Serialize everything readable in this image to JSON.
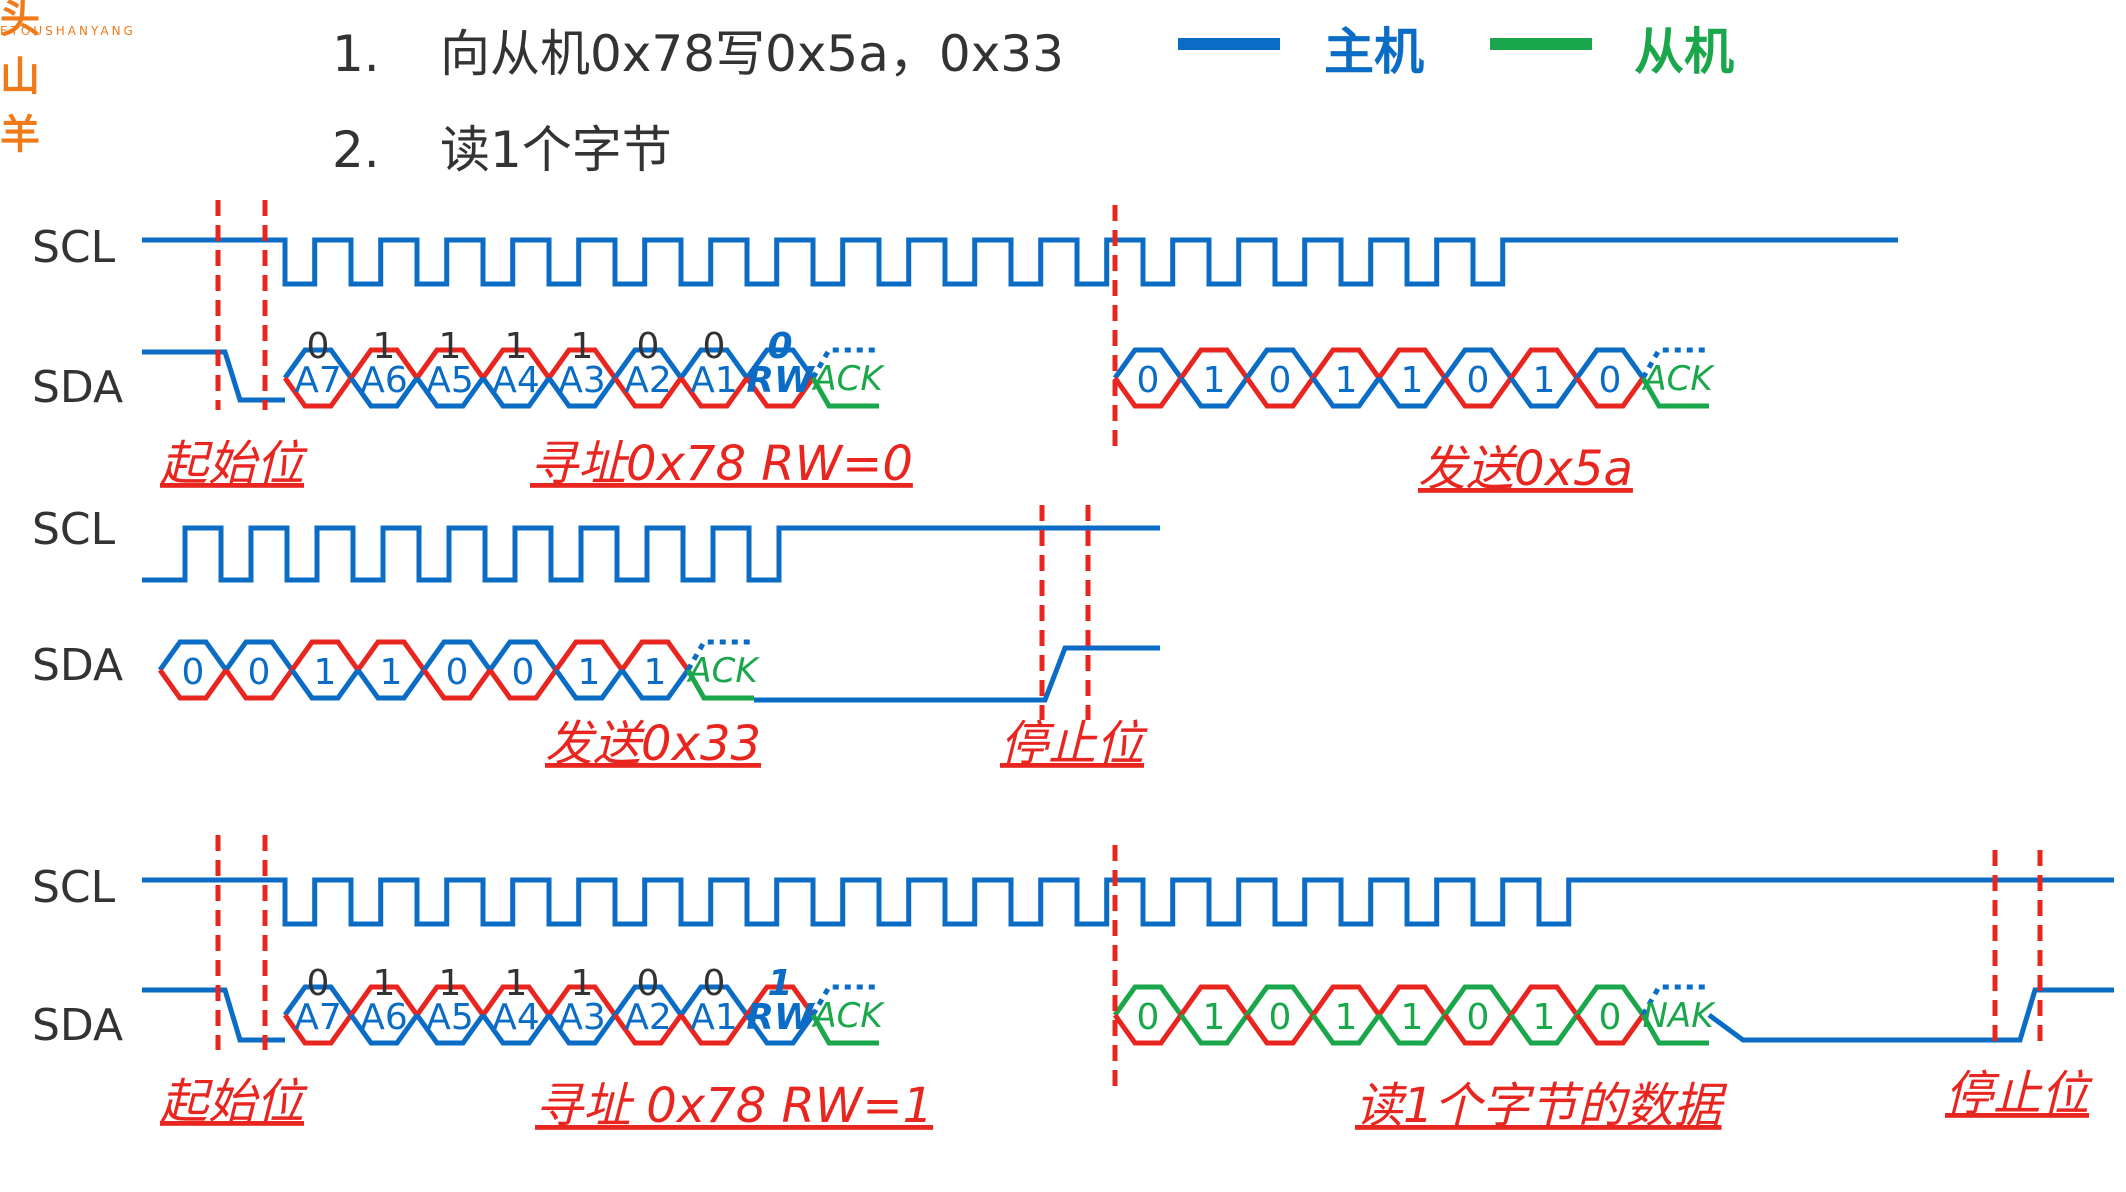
{
  "logo": {
    "brand_cn": "头山羊",
    "brand_en": "ETOUSHANYANG"
  },
  "instructions": [
    {
      "num": "1.",
      "text": "向从机0x78写0x5a，0x33"
    },
    {
      "num": "2.",
      "text": "读1个字节"
    }
  ],
  "legend": [
    {
      "label": "主机",
      "color": "#0b6cc6"
    },
    {
      "label": "从机",
      "color": "#1aa64a"
    }
  ],
  "colors": {
    "master": "#0b6cc6",
    "slave": "#1aa64a",
    "marker": "#e8251f"
  },
  "signals": {
    "scl": "SCL",
    "sda": "SDA"
  },
  "address_bits": [
    "0",
    "1",
    "1",
    "1",
    "1",
    "0",
    "0"
  ],
  "address_labels": [
    "A7",
    "A6",
    "A5",
    "A4",
    "A3",
    "A2",
    "A1",
    "RW"
  ],
  "ack": "ACK",
  "nak": "NAK",
  "section1": {
    "rw_bit": "0",
    "data_bits": [
      "0",
      "1",
      "0",
      "1",
      "1",
      "0",
      "1",
      "0"
    ],
    "labels": {
      "start": "起始位",
      "address": "寻址0x78  RW=0",
      "data": "发送0x5a"
    }
  },
  "section2": {
    "data_bits": [
      "0",
      "0",
      "1",
      "1",
      "0",
      "0",
      "1",
      "1"
    ],
    "labels": {
      "data": "发送0x33",
      "stop": "停止位"
    }
  },
  "section3": {
    "rw_bit": "1",
    "data_bits": [
      "0",
      "1",
      "0",
      "1",
      "1",
      "0",
      "1",
      "0"
    ],
    "labels": {
      "start": "起始位",
      "address": "寻址  0x78  RW=1",
      "data": "读1个字节的数据",
      "stop": "停止位"
    }
  }
}
